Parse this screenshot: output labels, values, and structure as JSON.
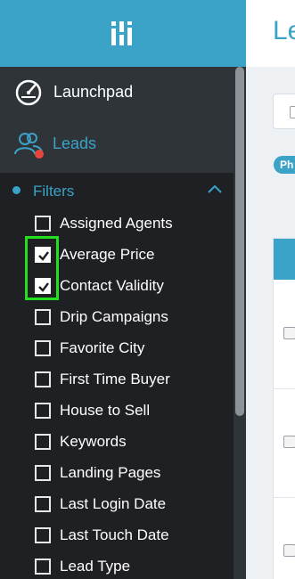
{
  "app": {
    "page_title": "Le",
    "accent_color": "#3aa3c7"
  },
  "sidebar": {
    "nav": [
      {
        "label": "Launchpad",
        "icon": "gauge-icon"
      },
      {
        "label": "Leads",
        "icon": "users-icon",
        "notification_dot": true
      }
    ],
    "filters": {
      "label": "Filters",
      "expanded": true,
      "items": [
        {
          "label": "Assigned Agents",
          "checked": false
        },
        {
          "label": "Average Price",
          "checked": true
        },
        {
          "label": "Contact Validity",
          "checked": true
        },
        {
          "label": "Drip Campaigns",
          "checked": false
        },
        {
          "label": "Favorite City",
          "checked": false
        },
        {
          "label": "First Time Buyer",
          "checked": false
        },
        {
          "label": "House to Sell",
          "checked": false
        },
        {
          "label": "Keywords",
          "checked": false
        },
        {
          "label": "Landing Pages",
          "checked": false
        },
        {
          "label": "Last Login Date",
          "checked": false
        },
        {
          "label": "Last Touch Date",
          "checked": false
        },
        {
          "label": "Lead Type",
          "checked": false
        }
      ]
    }
  },
  "main": {
    "tag_pill": "Ph"
  }
}
